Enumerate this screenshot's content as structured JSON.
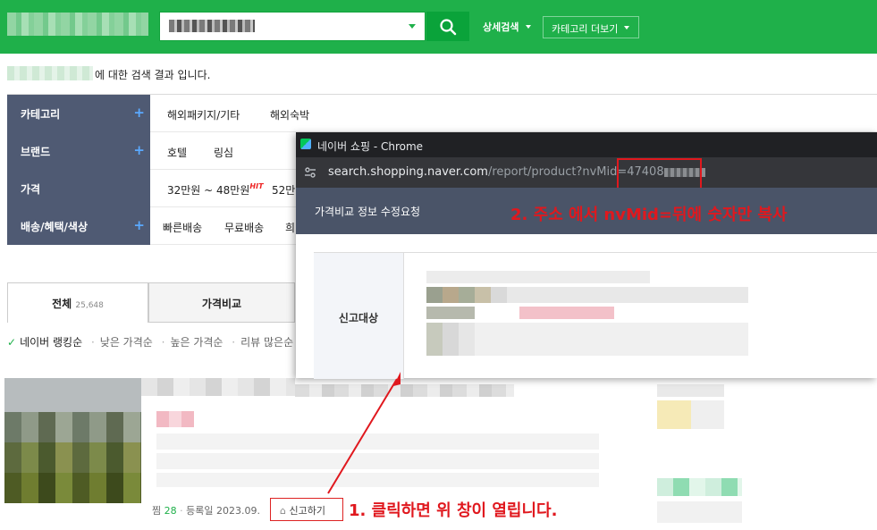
{
  "header": {
    "search_query": "",
    "detail_search_label": "상세검색",
    "category_more_label": "카테고리 더보기",
    "colors": {
      "brand_green": "#1fb04a",
      "search_button": "#0aa33a"
    }
  },
  "results": {
    "summary_suffix": "에 대한 검색 결과 입니다."
  },
  "filters": [
    {
      "label": "카테고리",
      "has_plus": true,
      "options": [
        "해외패키지/기타",
        "해외숙박"
      ]
    },
    {
      "label": "브랜드",
      "has_plus": true,
      "options": [
        "호텔",
        "링심"
      ]
    },
    {
      "label": "가격",
      "has_plus": false,
      "options": [
        "32만원 ~ 48만원",
        "52만"
      ],
      "hit_badge": "HIT"
    },
    {
      "label": "배송/혜택/색상",
      "has_plus": true,
      "options": [
        "빠른배송",
        "무료배송",
        "희"
      ]
    }
  ],
  "tabs": {
    "all_label": "전체",
    "all_count": "25,648",
    "compare_label": "가격비교"
  },
  "sort": {
    "active": "네이버 랭킹순",
    "items": [
      "낮은 가격순",
      "높은 가격순",
      "리뷰 많은순"
    ]
  },
  "product_meta": {
    "zzim_label": "찜",
    "zzim_count": "28",
    "registered": "등록일 2023.09.",
    "report_label": "신고하기"
  },
  "annotations": {
    "step1": "1. 클릭하면 위 창이 열립니다.",
    "step2": "2. 주소 에서 nvMid=뒤에 숫자만 복사",
    "color": "#e0181e"
  },
  "popup": {
    "window_title": "네이버 쇼핑 - Chrome",
    "url_host": "search.shopping.naver.com",
    "url_path": "/report/product?nvMid=47408",
    "header_title": "가격비교 정보 수정요청",
    "row_label": "신고대상",
    "colors": {
      "titlebar": "#202124",
      "addressbar": "#35363a",
      "header": "#4a5468"
    }
  }
}
